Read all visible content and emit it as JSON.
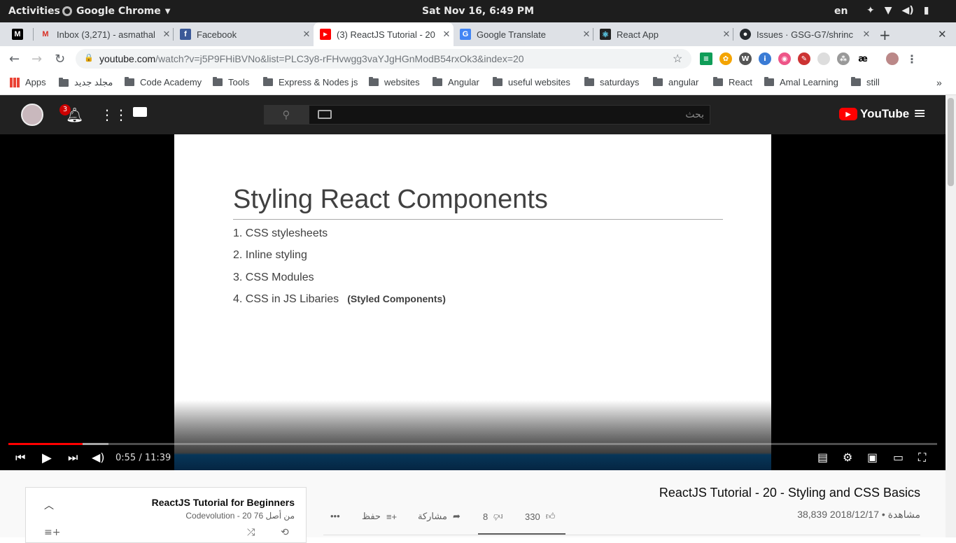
{
  "system": {
    "activities": "Activities",
    "app": "Google Chrome",
    "clock": "Sat Nov 16,  6:49 PM",
    "lang": "en"
  },
  "tabs": [
    {
      "title": "",
      "fav": "M",
      "favbg": "#000"
    },
    {
      "title": "Inbox (3,271) - asmathal",
      "fav": "M",
      "favbg": "#fff"
    },
    {
      "title": "Facebook",
      "fav": "f",
      "favbg": "#3b5998"
    },
    {
      "title": "(3) ReactJS Tutorial - 20",
      "fav": "▶",
      "favbg": "#f00"
    },
    {
      "title": "Google Translate",
      "fav": "G",
      "favbg": "#4285f4"
    },
    {
      "title": "React App",
      "fav": "⚛",
      "favbg": "#222"
    },
    {
      "title": "Issues · GSG-G7/shrinc",
      "fav": "●",
      "favbg": "#24292e"
    }
  ],
  "address": {
    "domain": "youtube.com",
    "path": "/watch?v=j5P9FHiBVNo&list=PLC3y8-rFHvwgg3vaYJgHGnModB54rxOk3&index=20"
  },
  "bookmarks": {
    "apps": "Apps",
    "items": [
      "مجلد جديد",
      "Code Academy",
      "Tools",
      "Express & Nodes js",
      "websites",
      "Angular",
      "useful websites",
      "saturdays",
      "angular",
      "React",
      "Amal Learning",
      "still"
    ]
  },
  "youtube": {
    "notifications": "3",
    "search_placeholder": "بحث",
    "logo": "YouTube"
  },
  "slide": {
    "title": "Styling React Components",
    "items": [
      "1. CSS stylesheets",
      "2. Inline styling",
      "3. CSS Modules",
      "4. CSS in JS Libaries"
    ],
    "note": "(Styled Components)"
  },
  "player": {
    "time": "0:55 / 11:39",
    "played": 0.08,
    "buffered": 0.108
  },
  "video": {
    "title": "ReactJS Tutorial - 20 - Styling and CSS Basics",
    "views": "38,839 مشاهدة • 2018/12/17",
    "likes": "330",
    "dislikes": "8",
    "share": "مشاركة",
    "save": "حفظ"
  },
  "playlist": {
    "title": "ReactJS Tutorial for Beginners",
    "subtitle": "Codevolution - 20 من أصل 76"
  },
  "colors": {
    "youtube_red": "#ff0000",
    "chrome_tab_bar": "#dee1e6",
    "yt_header": "#212121"
  }
}
